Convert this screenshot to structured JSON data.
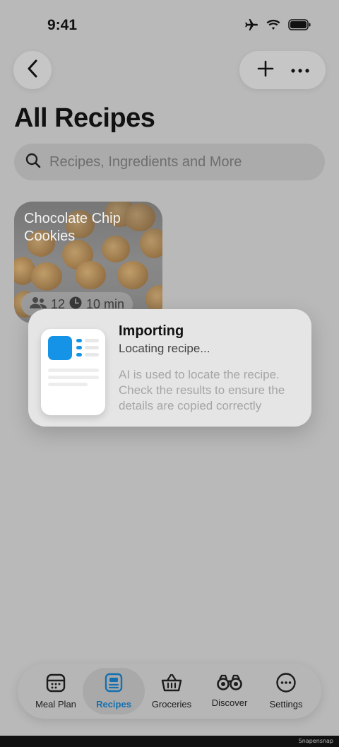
{
  "status": {
    "time": "9:41"
  },
  "header": {
    "title": "All Recipes"
  },
  "search": {
    "placeholder": "Recipes, Ingredients and More"
  },
  "recipe_card": {
    "title": "Chocolate Chip Cookies",
    "servings": "12",
    "time": "10 min"
  },
  "toast": {
    "title": "Importing",
    "status": "Locating recipe...",
    "note": "AI is used to locate the recipe. Check the results to ensure the details are copied correctly"
  },
  "tabs": [
    {
      "label": "Meal Plan",
      "icon": "calendar-icon"
    },
    {
      "label": "Recipes",
      "icon": "recipe-book-icon",
      "active": true
    },
    {
      "label": "Groceries",
      "icon": "basket-icon"
    },
    {
      "label": "Discover",
      "icon": "binoculars-icon"
    },
    {
      "label": "Settings",
      "icon": "ellipsis-circle-icon"
    }
  ],
  "watermark": "Snapensnap",
  "colors": {
    "accent": "#1570b0",
    "thumb": "#1593e6"
  }
}
